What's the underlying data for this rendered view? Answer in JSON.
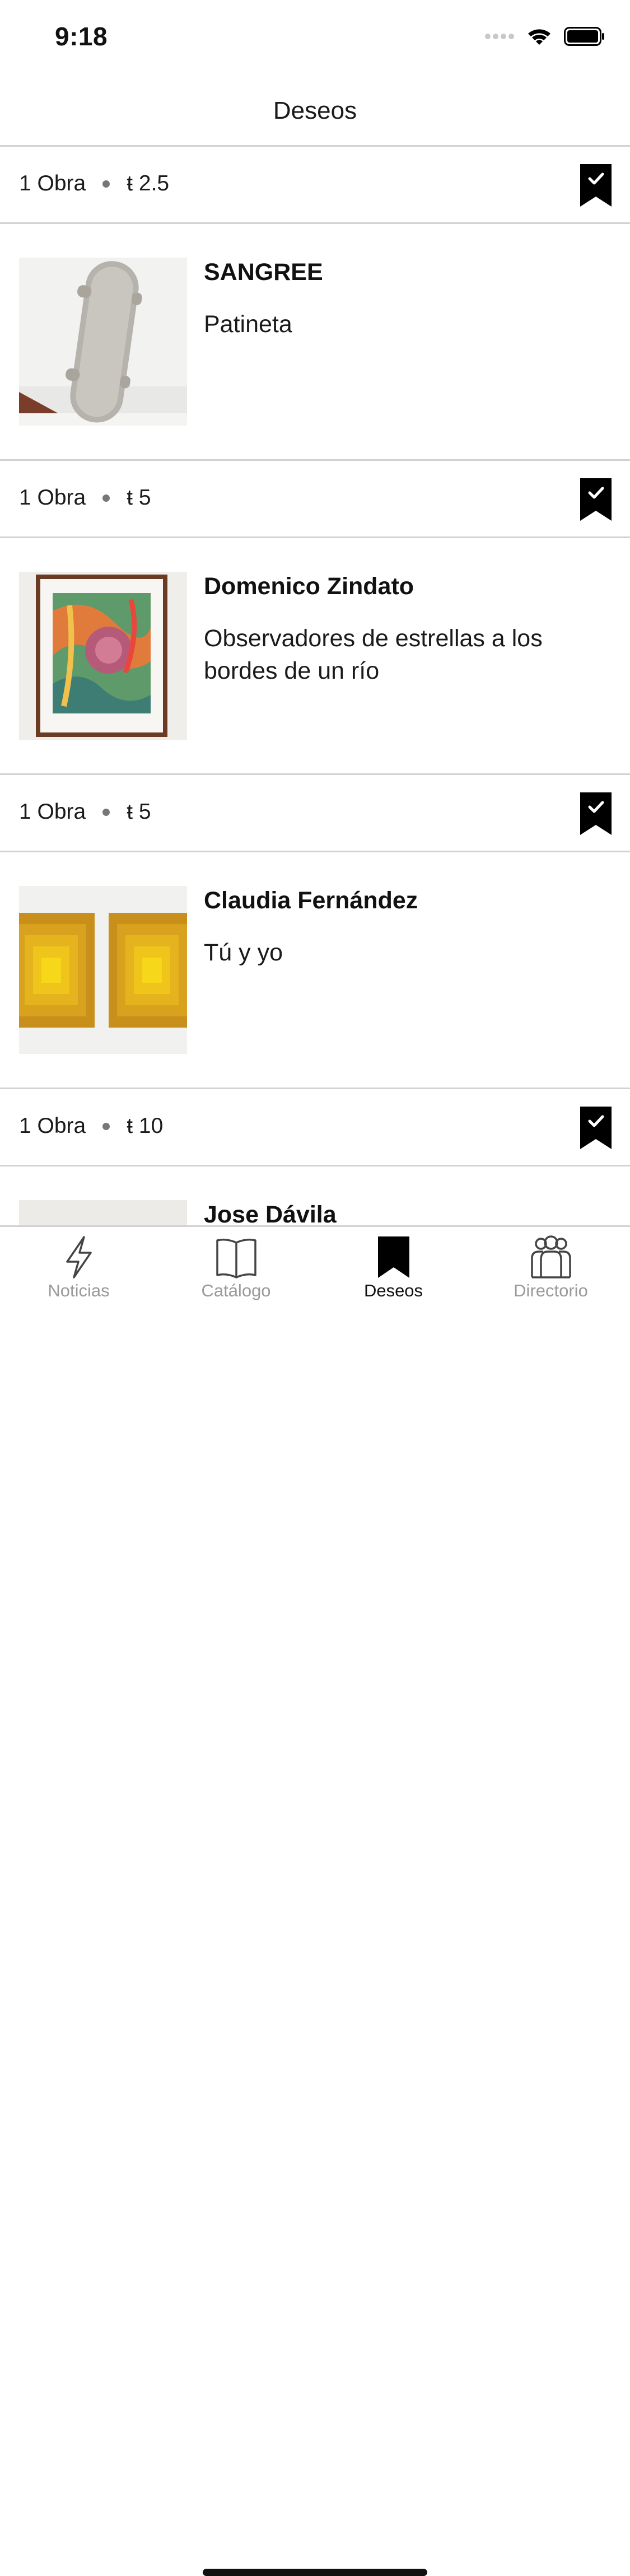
{
  "status": {
    "time": "9:18"
  },
  "header": {
    "title": "Deseos"
  },
  "sections": [
    {
      "count": "1 Obra",
      "price": "ŧ 2.5",
      "artist": "SANGREE",
      "title": "Patineta",
      "saved_icon": "bookmark-check-icon"
    },
    {
      "count": "1 Obra",
      "price": "ŧ 5",
      "artist": "Domenico Zindato",
      "title": "Observadores de estrellas a los bordes de un río",
      "saved_icon": "bookmark-check-icon"
    },
    {
      "count": "1 Obra",
      "price": "ŧ 5",
      "artist": "Claudia Fernández",
      "title": "Tú y yo",
      "saved_icon": "bookmark-check-icon"
    },
    {
      "count": "1 Obra",
      "price": "ŧ 10",
      "artist": "Jose Dávila",
      "title": "",
      "saved_icon": "bookmark-check-icon"
    }
  ],
  "tabs": [
    {
      "label": "Noticias",
      "icon": "lightning-icon",
      "active": false
    },
    {
      "label": "Catálogo",
      "icon": "book-icon",
      "active": false
    },
    {
      "label": "Deseos",
      "icon": "bookmark-icon",
      "active": true
    },
    {
      "label": "Directorio",
      "icon": "people-icon",
      "active": false
    }
  ],
  "colors": {
    "accent": "#000000",
    "divider": "#d2d2d2",
    "inactive_tab": "#9a9a9a"
  }
}
